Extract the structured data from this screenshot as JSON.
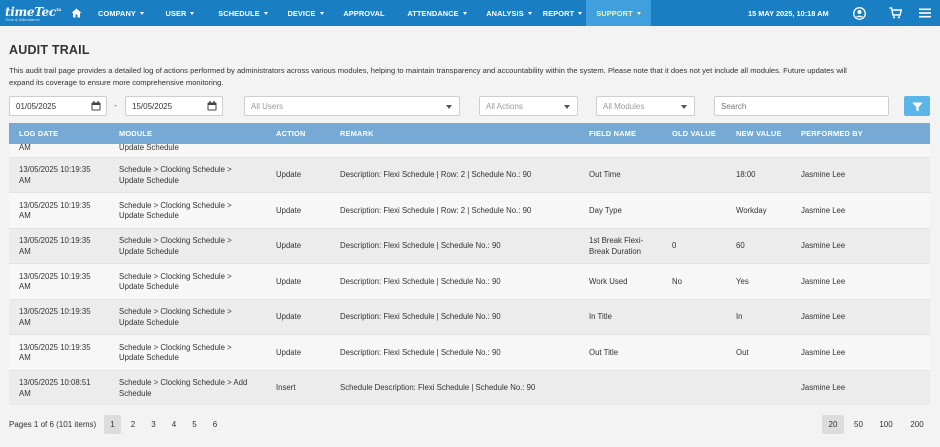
{
  "nav": {
    "logo": {
      "name": "timeTec",
      "sup": "TA",
      "tagline": "Time & Attendance"
    },
    "items": [
      {
        "label": "COMPANY",
        "dropdown": true
      },
      {
        "label": "USER",
        "dropdown": true
      },
      {
        "label": "SCHEDULE",
        "dropdown": true
      },
      {
        "label": "DEVICE",
        "dropdown": true
      },
      {
        "label": "APPROVAL",
        "dropdown": false
      },
      {
        "label": "ATTENDANCE",
        "dropdown": true
      },
      {
        "label": "ANALYSIS",
        "dropdown": true
      },
      {
        "label": "REPORT",
        "dropdown": true
      },
      {
        "label": "SUPPORT",
        "dropdown": true,
        "active": true
      }
    ],
    "datetime": "15 MAY 2025, 10:18 AM",
    "icons": [
      "home-icon",
      "user-circle-icon",
      "cart-icon",
      "menu-icon"
    ]
  },
  "page": {
    "title": "AUDIT TRAIL",
    "description": "This audit trail page provides a detailed log of actions performed by administrators across various modules, helping to maintain transparency and accountability within the system. Please note that it does not yet include all modules. Future updates will expand its coverage to ensure more comprehensive monitoring."
  },
  "filters": {
    "date_from": "01/05/2025",
    "date_to": "15/05/2025",
    "users": "All Users",
    "actions": "All Actions",
    "modules": "All Modules",
    "search_placeholder": "Search"
  },
  "table": {
    "headers": {
      "log_date": "LOG DATE",
      "module": "MODULE",
      "action": "ACTION",
      "remark": "REMARK",
      "field_name": "FIELD NAME",
      "old_value": "OLD VALUE",
      "new_value": "NEW VALUE",
      "performed_by": "PERFORMED BY"
    },
    "partial_row": {
      "log_date_tail": "AM",
      "module_tail": "Update Schedule"
    },
    "rows": [
      {
        "date": "13/05/2025 10:19:35",
        "time": "AM",
        "mod1": "Schedule > Clocking Schedule >",
        "mod2": "Update Schedule",
        "action": "Update",
        "remark": "Description: Flexi Schedule | Row: 2 | Schedule No.: 90",
        "f1": "Out Time",
        "f2": "",
        "old": "",
        "new": "18:00",
        "by": "Jasmine Lee"
      },
      {
        "date": "13/05/2025 10:19:35",
        "time": "AM",
        "mod1": "Schedule > Clocking Schedule >",
        "mod2": "Update Schedule",
        "action": "Update",
        "remark": "Description: Flexi Schedule | Row: 2 | Schedule No.: 90",
        "f1": "Day Type",
        "f2": "",
        "old": "",
        "new": "Workday",
        "by": "Jasmine Lee"
      },
      {
        "date": "13/05/2025 10:19:35",
        "time": "AM",
        "mod1": "Schedule > Clocking Schedule >",
        "mod2": "Update Schedule",
        "action": "Update",
        "remark": "Description: Flexi Schedule | Schedule No.: 90",
        "f1": "1st Break Flexi-",
        "f2": "Break Duration",
        "old": "0",
        "new": "60",
        "by": "Jasmine Lee"
      },
      {
        "date": "13/05/2025 10:19:35",
        "time": "AM",
        "mod1": "Schedule > Clocking Schedule >",
        "mod2": "Update Schedule",
        "action": "Update",
        "remark": "Description: Flexi Schedule | Schedule No.: 90",
        "f1": "Work Used",
        "f2": "",
        "old": "No",
        "new": "Yes",
        "by": "Jasmine Lee"
      },
      {
        "date": "13/05/2025 10:19:35",
        "time": "AM",
        "mod1": "Schedule > Clocking Schedule >",
        "mod2": "Update Schedule",
        "action": "Update",
        "remark": "Description: Flexi Schedule | Schedule No.: 90",
        "f1": "In Title",
        "f2": "",
        "old": "",
        "new": "In",
        "by": "Jasmine Lee"
      },
      {
        "date": "13/05/2025 10:19:35",
        "time": "AM",
        "mod1": "Schedule > Clocking Schedule >",
        "mod2": "Update Schedule",
        "action": "Update",
        "remark": "Description: Flexi Schedule | Schedule No.: 90",
        "f1": "Out Title",
        "f2": "",
        "old": "",
        "new": "Out",
        "by": "Jasmine Lee"
      },
      {
        "date": "13/05/2025 10:08:51",
        "time": "AM",
        "mod1": "Schedule > Clocking Schedule > Add",
        "mod2": "Schedule",
        "action": "Insert",
        "remark": "Schedule Description: Flexi Schedule | Schedule No.: 90",
        "f1": "",
        "f2": "",
        "old": "",
        "new": "",
        "by": "Jasmine Lee"
      }
    ]
  },
  "pagination": {
    "info": "Pages 1 of 6 (101 items)",
    "pages": [
      "1",
      "2",
      "3",
      "4",
      "5",
      "6"
    ],
    "current_page": "1",
    "sizes": [
      "20",
      "50",
      "100",
      "200"
    ],
    "current_size": "20"
  },
  "colors": {
    "nav_bg": "#1a7fc2",
    "nav_active_bg": "#3fa0dd",
    "nav_active_text": "#fdf3a3",
    "table_header": "#76a9d4",
    "filter_button": "#5ab6e8"
  }
}
